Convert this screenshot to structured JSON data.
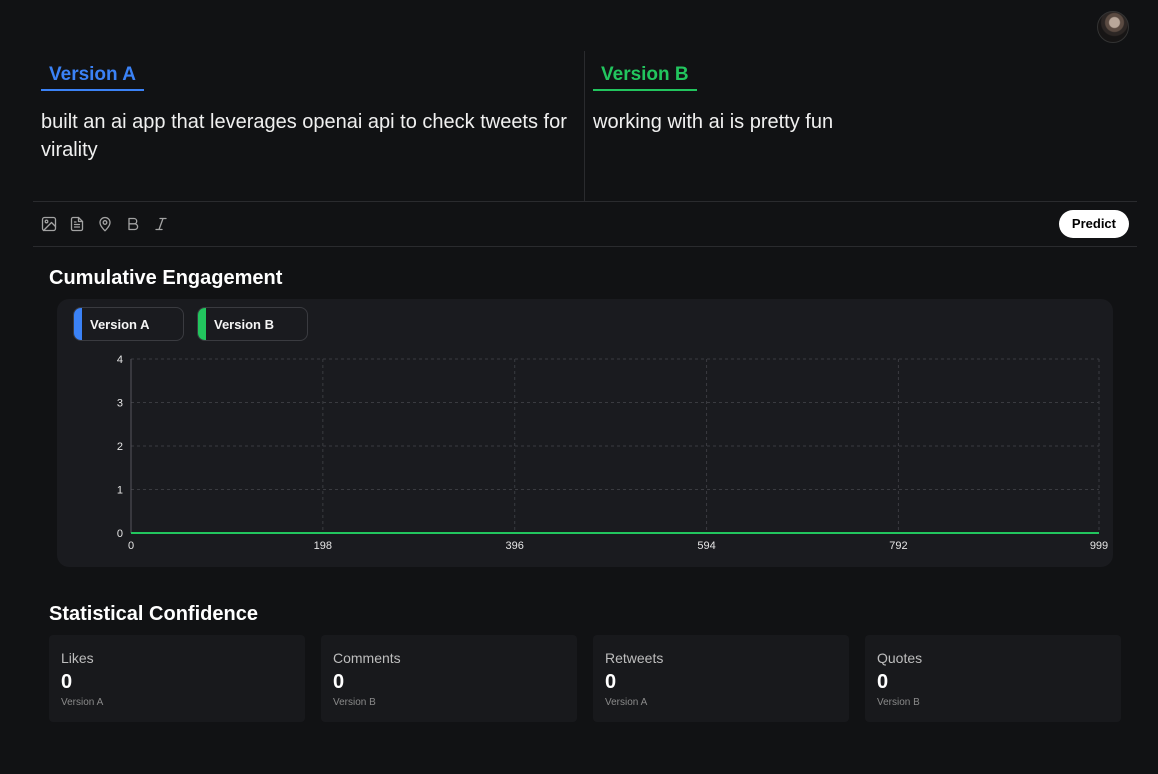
{
  "editor": {
    "version_a": {
      "label": "Version A",
      "text": "built an ai app that leverages openai api to check tweets for virality"
    },
    "version_b": {
      "label": "Version B",
      "text": "working with ai is pretty fun"
    }
  },
  "toolbar": {
    "icons": [
      "image-icon",
      "document-icon",
      "location-pin-icon",
      "bold-icon",
      "italic-icon"
    ],
    "predict_label": "Predict"
  },
  "engagement": {
    "title": "Cumulative Engagement",
    "legend": [
      {
        "name": "Version A",
        "color": "#3b82f6"
      },
      {
        "name": "Version B",
        "color": "#22c55e"
      }
    ]
  },
  "chart_data": {
    "type": "line",
    "title": "",
    "xlabel": "",
    "ylabel": "",
    "x": [
      0,
      999
    ],
    "x_ticks": [
      0,
      198,
      396,
      594,
      792,
      999
    ],
    "y_ticks": [
      0,
      1,
      2,
      3,
      4
    ],
    "xlim": [
      0,
      999
    ],
    "ylim": [
      0,
      4
    ],
    "grid": true,
    "legend_position": "top-left",
    "series": [
      {
        "name": "Version A",
        "color": "#3b82f6",
        "values": [
          0,
          0
        ]
      },
      {
        "name": "Version B",
        "color": "#22c55e",
        "values": [
          0,
          0
        ]
      }
    ]
  },
  "confidence": {
    "title": "Statistical Confidence",
    "cards": [
      {
        "label": "Likes",
        "value": "0",
        "sub": "Version A"
      },
      {
        "label": "Comments",
        "value": "0",
        "sub": "Version B"
      },
      {
        "label": "Retweets",
        "value": "0",
        "sub": "Version A"
      },
      {
        "label": "Quotes",
        "value": "0",
        "sub": "Version B"
      }
    ]
  }
}
